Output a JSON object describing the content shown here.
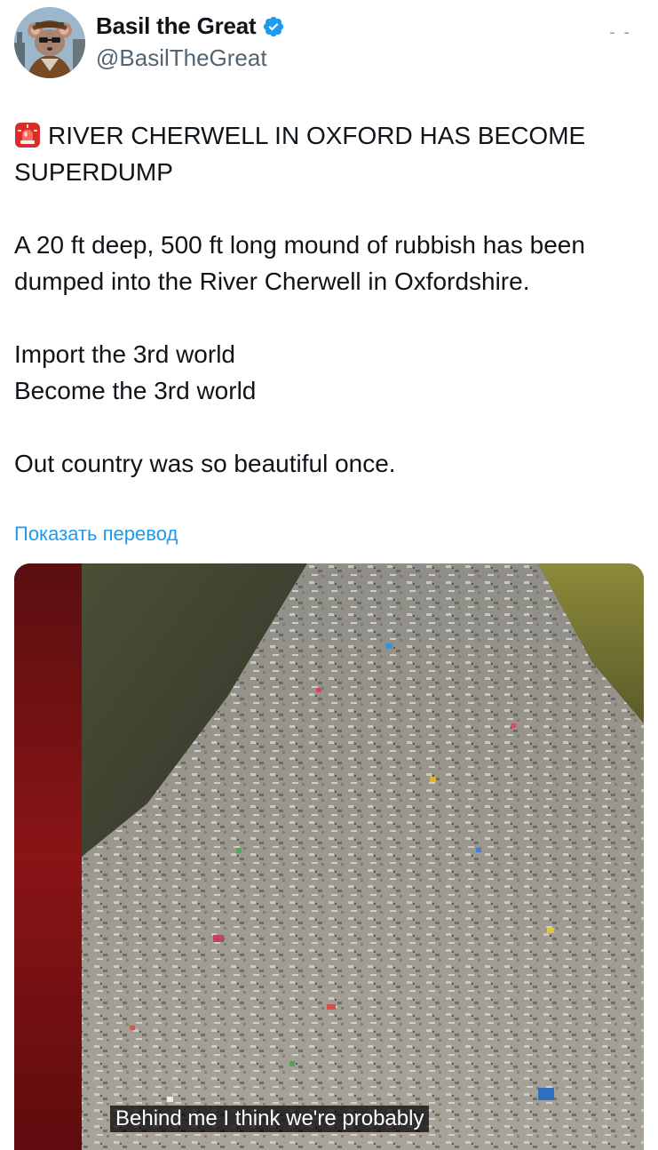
{
  "author": {
    "display_name": "Basil the Great",
    "handle": "@BasilTheGreat",
    "verified": true,
    "avatar_icon": "mouse-detective-avatar-icon"
  },
  "more_menu": {
    "label": "- -"
  },
  "tweet": {
    "headline": "RIVER CHERWELL IN OXFORD HAS BECOME SUPERDUMP",
    "headline_icon": "siren-emoji-icon",
    "paragraph_1": "A 20 ft deep, 500 ft long mound of rubbish has been dumped into the River Cherwell in Oxfordshire.",
    "paragraph_2_line_1": "Import the 3rd world",
    "paragraph_2_line_2": "Become the 3rd world",
    "paragraph_3": "Out country was so beautiful once."
  },
  "translate_link": "Показать перевод",
  "media": {
    "type": "video",
    "caption": "Behind me I think we're probably"
  },
  "colors": {
    "link_blue": "#1d9bf0",
    "verified_blue": "#1d9bf0",
    "handle_gray": "#536471",
    "text": "#0f1419"
  }
}
